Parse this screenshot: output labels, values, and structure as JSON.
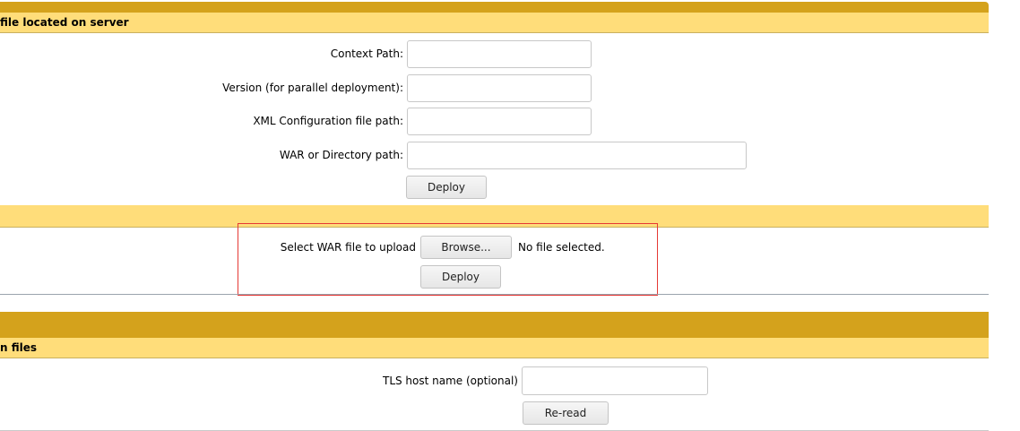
{
  "deploy_directory": {
    "header": "file located on server",
    "fields": [
      {
        "label": "Context Path:",
        "value": ""
      },
      {
        "label": "Version (for parallel deployment):",
        "value": ""
      },
      {
        "label": "XML Configuration file path:",
        "value": ""
      },
      {
        "label": "WAR or Directory path:",
        "value": ""
      }
    ],
    "deploy_button": "Deploy"
  },
  "upload_war": {
    "select_label": "Select WAR file to upload",
    "browse_button": "Browse...",
    "file_status": "No file selected.",
    "deploy_button": "Deploy",
    "highlight_color": "#e53935"
  },
  "tls_config": {
    "header": "n files",
    "host_label": "TLS host name (optional)",
    "host_value": "",
    "reread_button": "Re-read"
  },
  "colors": {
    "header_gold": "#d4a21c",
    "header_yellow": "#ffdd7a"
  }
}
